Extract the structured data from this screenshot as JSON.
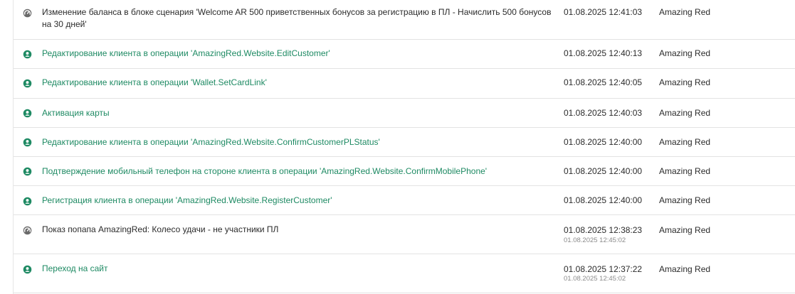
{
  "colors": {
    "accent": "#1e8a63",
    "system_icon": "#6a6a6a",
    "text": "#2b2b2b",
    "divider": "#e3e3e3",
    "subtime": "#8a8a8a"
  },
  "events": [
    {
      "icon": "system-gauge-icon",
      "description": "Изменение баланса в блоке сценария 'Welcome AR 500 приветственных бонусов за регистрацию в ПЛ - Начислить 500 бонусов на 30 дней'",
      "time": "01.08.2025 12:41:03",
      "subtime": "",
      "author": "Amazing Red"
    },
    {
      "icon": "customer-icon",
      "description": "Редактирование клиента в операции 'AmazingRed.Website.EditCustomer'",
      "time": "01.08.2025 12:40:13",
      "subtime": "",
      "author": "Amazing Red"
    },
    {
      "icon": "customer-icon",
      "description": "Редактирование клиента в операции 'Wallet.SetCardLink'",
      "time": "01.08.2025 12:40:05",
      "subtime": "",
      "author": "Amazing Red"
    },
    {
      "icon": "customer-icon",
      "description": "Активация карты",
      "time": "01.08.2025 12:40:03",
      "subtime": "",
      "author": "Amazing Red"
    },
    {
      "icon": "customer-icon",
      "description": "Редактирование клиента в операции 'AmazingRed.Website.ConfirmCustomerPLStatus'",
      "time": "01.08.2025 12:40:00",
      "subtime": "",
      "author": "Amazing Red"
    },
    {
      "icon": "customer-icon",
      "description": "Подтверждение мобильный телефон на стороне клиента в операции 'AmazingRed.Website.ConfirmMobilePhone'",
      "time": "01.08.2025 12:40:00",
      "subtime": "",
      "author": "Amazing Red"
    },
    {
      "icon": "customer-icon",
      "description": "Регистрация клиента в операции 'AmazingRed.Website.RegisterCustomer'",
      "time": "01.08.2025 12:40:00",
      "subtime": "",
      "author": "Amazing Red"
    },
    {
      "icon": "system-gauge-icon",
      "description": "Показ попапа AmazingRed: Колесо удачи - не участники ПЛ",
      "time": "01.08.2025 12:38:23",
      "subtime": "01.08.2025 12:45:02",
      "author": "Amazing Red"
    },
    {
      "icon": "customer-icon",
      "description": "Переход на сайт",
      "time": "01.08.2025 12:37:22",
      "subtime": "01.08.2025 12:45:02",
      "author": "Amazing Red"
    }
  ]
}
